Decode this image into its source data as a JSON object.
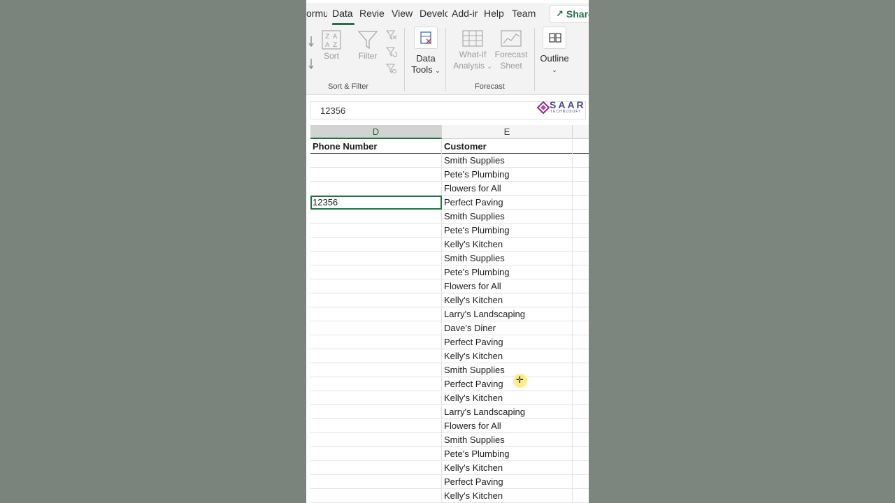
{
  "ribbon_tabs": [
    {
      "label": "ormu",
      "active": false
    },
    {
      "label": "Data",
      "active": true
    },
    {
      "label": "Revie",
      "active": false
    },
    {
      "label": "View",
      "active": false
    },
    {
      "label": "Develo",
      "active": false
    },
    {
      "label": "Add-ir",
      "active": false
    },
    {
      "label": "Help",
      "active": false
    },
    {
      "label": "Team",
      "active": false
    }
  ],
  "share_label": "Share",
  "ribbon": {
    "sort_label": "Sort",
    "filter_label": "Filter",
    "data_tools_label1": "Data",
    "data_tools_label2": "Tools",
    "whatif_label1": "What-If",
    "whatif_label2": "Analysis",
    "forecast_label1": "Forecast",
    "forecast_label2": "Sheet",
    "outline_label": "Outline",
    "group_sort_filter": "Sort & Filter",
    "group_forecast": "Forecast"
  },
  "formula_bar": {
    "value": "12356"
  },
  "logo": {
    "name": "SAAR",
    "sub": "TECHNOSOFT"
  },
  "columns": [
    "D",
    "E"
  ],
  "selected_column": "D",
  "headers": {
    "d": "Phone Number",
    "e": "Customer"
  },
  "rows": [
    {
      "d": "",
      "e": "Smith Supplies"
    },
    {
      "d": "",
      "e": "Pete's Plumbing"
    },
    {
      "d": "",
      "e": "Flowers for All"
    },
    {
      "d": "12356",
      "e": "Perfect Paving"
    },
    {
      "d": "",
      "e": "Smith Supplies"
    },
    {
      "d": "",
      "e": "Pete's Plumbing"
    },
    {
      "d": "",
      "e": "Kelly's Kitchen"
    },
    {
      "d": "",
      "e": "Smith Supplies"
    },
    {
      "d": "",
      "e": "Pete's Plumbing"
    },
    {
      "d": "",
      "e": "Flowers for All"
    },
    {
      "d": "",
      "e": "Kelly's Kitchen"
    },
    {
      "d": "",
      "e": "Larry's Landscaping"
    },
    {
      "d": "",
      "e": "Dave's Diner"
    },
    {
      "d": "",
      "e": "Perfect Paving"
    },
    {
      "d": "",
      "e": "Kelly's Kitchen"
    },
    {
      "d": "",
      "e": "Smith Supplies"
    },
    {
      "d": "",
      "e": "Perfect Paving"
    },
    {
      "d": "",
      "e": "Kelly's Kitchen"
    },
    {
      "d": "",
      "e": "Larry's Landscaping"
    },
    {
      "d": "",
      "e": "Flowers for All"
    },
    {
      "d": "",
      "e": "Smith Supplies"
    },
    {
      "d": "",
      "e": "Pete's Plumbing"
    },
    {
      "d": "",
      "e": "Kelly's Kitchen"
    },
    {
      "d": "",
      "e": "Perfect Paving"
    },
    {
      "d": "",
      "e": "Kelly's Kitchen"
    }
  ],
  "colors": {
    "accent": "#217346",
    "background": "#7b847d"
  }
}
